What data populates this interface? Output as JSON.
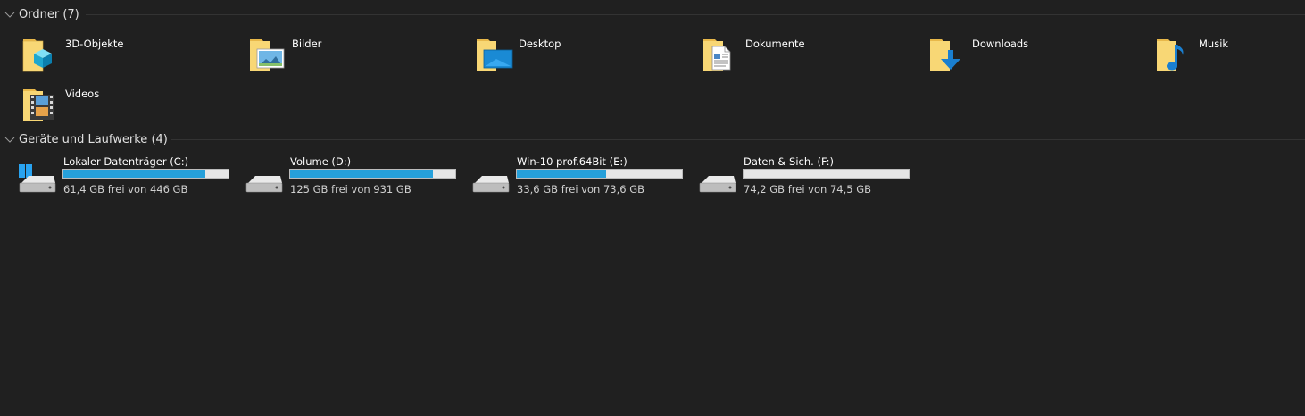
{
  "groups": {
    "folders": {
      "title": "Ordner (7)",
      "items": [
        {
          "label": "3D-Objekte",
          "icon": "folder-3d-objects-icon"
        },
        {
          "label": "Bilder",
          "icon": "folder-pictures-icon"
        },
        {
          "label": "Desktop",
          "icon": "folder-desktop-icon"
        },
        {
          "label": "Dokumente",
          "icon": "folder-documents-icon"
        },
        {
          "label": "Downloads",
          "icon": "folder-downloads-icon"
        },
        {
          "label": "Musik",
          "icon": "folder-music-icon"
        },
        {
          "label": "Videos",
          "icon": "folder-videos-icon"
        }
      ]
    },
    "drives": {
      "title": "Geräte und Laufwerke (4)",
      "items": [
        {
          "name": "Lokaler Datenträger (C:)",
          "free_text": "61,4 GB frei von 446 GB",
          "used_fraction": 0.862,
          "icon": "windows-drive-icon"
        },
        {
          "name": "Volume (D:)",
          "free_text": "125 GB frei von 931 GB",
          "used_fraction": 0.866,
          "icon": "hard-drive-icon"
        },
        {
          "name": "Win-10 prof.64Bit (E:)",
          "free_text": "33,6 GB frei von 73,6 GB",
          "used_fraction": 0.543,
          "icon": "hard-drive-icon"
        },
        {
          "name": "Daten & Sich. (F:)",
          "free_text": "74,2 GB frei von 74,5 GB",
          "used_fraction": 0.004,
          "icon": "hard-drive-icon"
        }
      ]
    }
  },
  "colors": {
    "background": "#202020",
    "usage_bar": "#26a0da",
    "usage_track": "#e6e6e6",
    "folder_yellow": "#f8d775"
  }
}
